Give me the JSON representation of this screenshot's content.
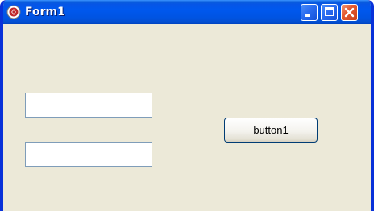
{
  "window": {
    "title": "Form1",
    "title_icon": "app-icon"
  },
  "caption_buttons": {
    "minimize_icon": "minimize-icon",
    "maximize_icon": "maximize-icon",
    "close_icon": "close-icon"
  },
  "form": {
    "textbox1_value": "",
    "textbox2_value": "",
    "button1_label": "button1"
  },
  "colors": {
    "titlebar": "#0054e3",
    "frame": "#0831d9",
    "client_background": "#ece9d8",
    "close_button": "#e45a30"
  }
}
